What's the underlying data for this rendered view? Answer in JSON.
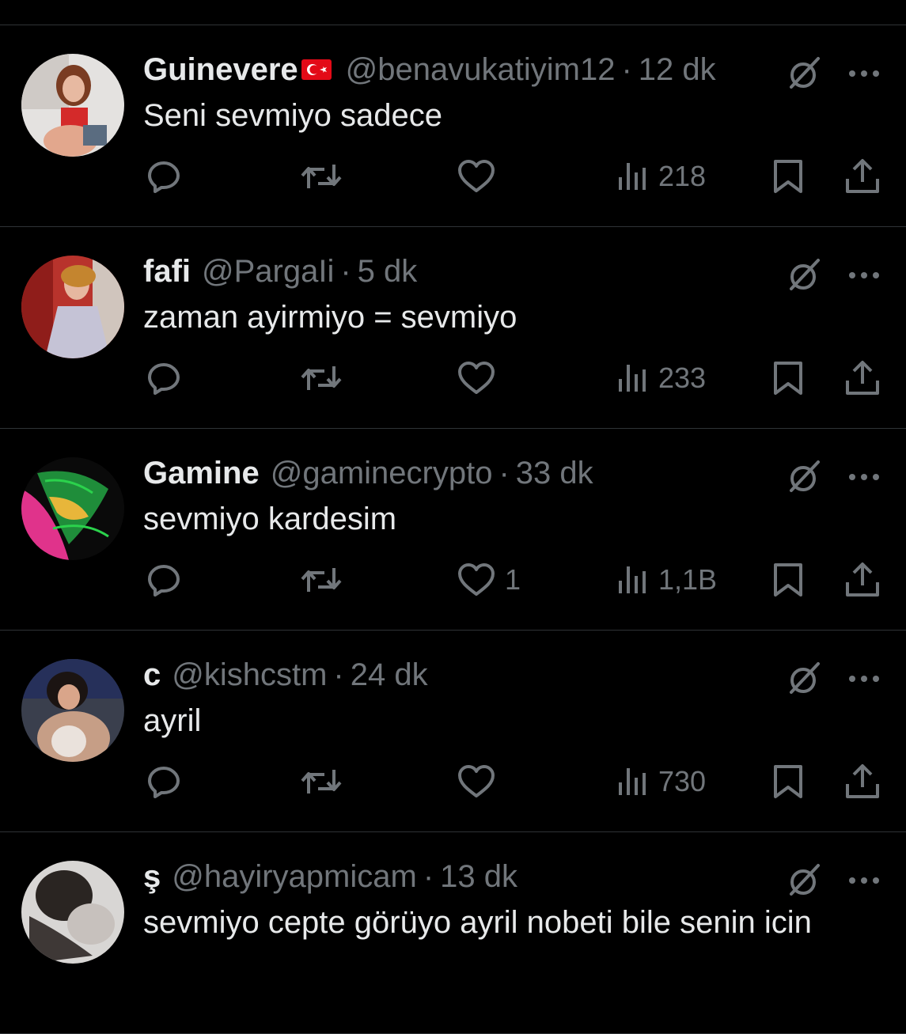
{
  "colors": {
    "background": "#000000",
    "divider": "#2f3336",
    "text_primary": "#e7e9ea",
    "text_secondary": "#71767b"
  },
  "tweets": [
    {
      "display_name": "Guinevere",
      "flag": "turkey-flag",
      "handle": "@benavukatiyim12",
      "separator": "·",
      "time": "12 dk",
      "text": "Seni sevmiyo sadece",
      "likes": "",
      "views": "218"
    },
    {
      "display_name": "fafi",
      "flag": "",
      "handle": "@PargaIi",
      "separator": "·",
      "time": "5 dk",
      "text": "zaman ayirmiyo = sevmiyo",
      "likes": "",
      "views": "233"
    },
    {
      "display_name": "Gamine",
      "flag": "",
      "handle": "@gaminecrypto",
      "separator": "·",
      "time": "33 dk",
      "text": "sevmiyo kardesim",
      "likes": "1",
      "views": "1,1B"
    },
    {
      "display_name": "c",
      "flag": "",
      "handle": "@kishcstm",
      "separator": "·",
      "time": "24 dk",
      "text": "ayril",
      "likes": "",
      "views": "730"
    },
    {
      "display_name": "ş",
      "flag": "",
      "handle": "@hayiryapmicam",
      "separator": "·",
      "time": "13 dk",
      "text": "sevmiyo cepte görüyo ayril nobeti bile senin icin",
      "likes": "",
      "views": ""
    }
  ],
  "icons": {
    "reply": "reply-icon",
    "retweet": "retweet-icon",
    "like": "heart-icon",
    "views": "views-icon",
    "bookmark": "bookmark-icon",
    "share": "share-icon",
    "grok": "grok-icon",
    "more": "more-icon"
  }
}
